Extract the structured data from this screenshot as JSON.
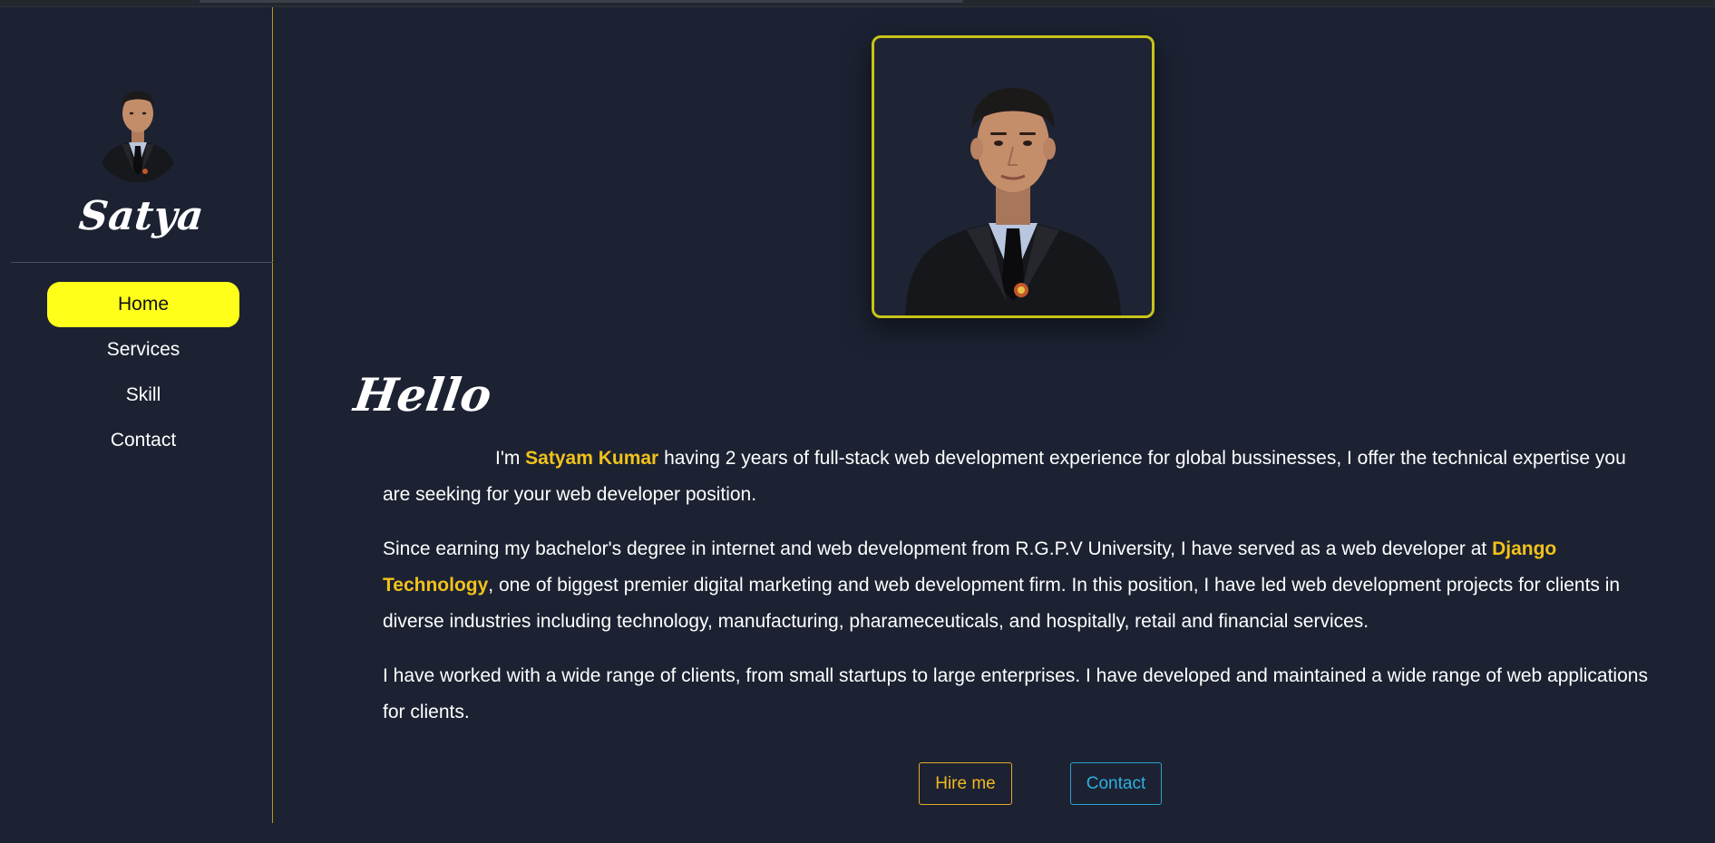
{
  "colors": {
    "background": "#1c2232",
    "accent_yellow": "#ffff1a",
    "highlight": "#f2c21b",
    "hire_button": "#f2b822",
    "contact_button": "#2fb0e0",
    "photo_border": "#c8c31a"
  },
  "sidebar": {
    "avatar_icon": "profile-photo",
    "brand": "Satya",
    "nav": [
      {
        "label": "Home",
        "active": true
      },
      {
        "label": "Services",
        "active": false
      },
      {
        "label": "Skill",
        "active": false
      },
      {
        "label": "Contact",
        "active": false
      }
    ]
  },
  "main": {
    "photo_icon": "profile-photo",
    "heading": "Hello",
    "intro": {
      "prefix": "I'm ",
      "name": "Satyam Kumar",
      "rest": " having 2 years of full-stack web development experience for global bussinesses, I offer the technical expertise you are seeking for your web developer position."
    },
    "para2": {
      "before": "Since earning my bachelor's degree in internet and web development from R.G.P.V University, I have served as a web developer at ",
      "company": "Django Technology",
      "after": ", one of biggest premier digital marketing and web development firm. In this position, I have led web development projects for clients in diverse industries including technology, manufacturing, pharameceuticals, and hospitally, retail and financial services."
    },
    "para3": "I have worked with a wide range of clients, from small startups to large enterprises. I have developed and maintained a wide range of web applications for clients.",
    "buttons": {
      "hire": "Hire me",
      "contact": "Contact"
    }
  }
}
